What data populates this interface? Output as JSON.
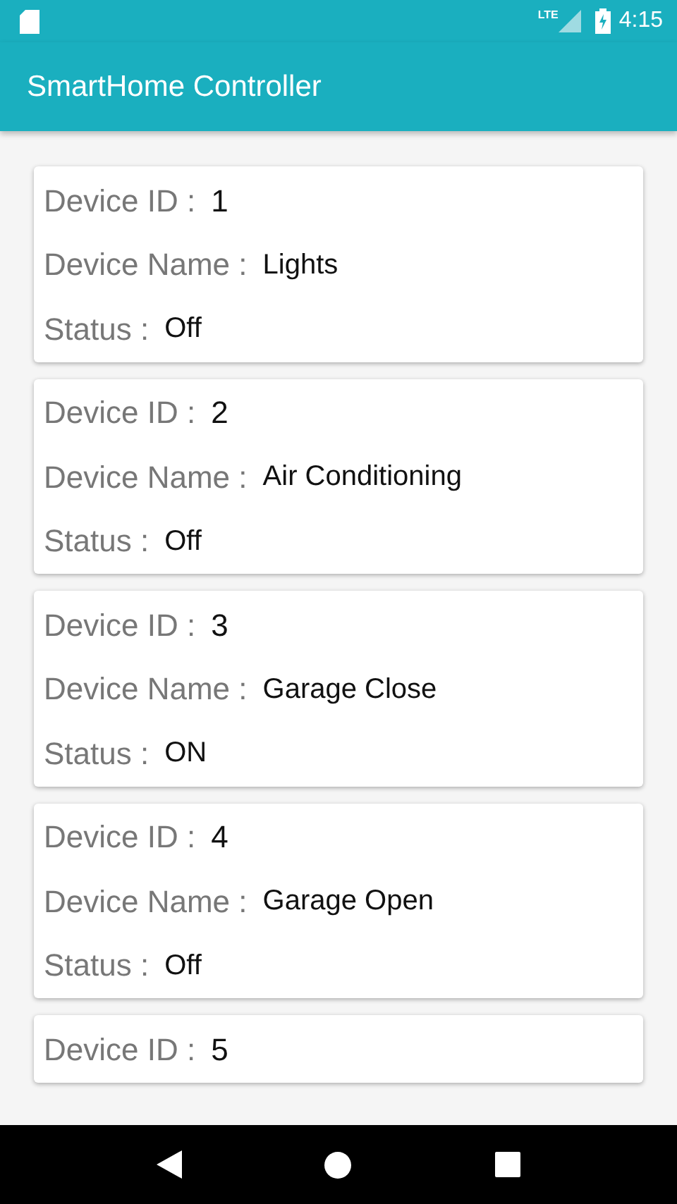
{
  "status_bar": {
    "network": "LTE",
    "time": "4:15"
  },
  "app_bar": {
    "title": "SmartHome Controller"
  },
  "devices": [
    {
      "fields": [
        {
          "label": "Device ID :",
          "value": "1"
        },
        {
          "label": "Device Name :",
          "value": "Lights"
        },
        {
          "label": "Status :",
          "value": "Off"
        }
      ]
    },
    {
      "fields": [
        {
          "label": "Device ID :",
          "value": "2"
        },
        {
          "label": "Device Name :",
          "value": "Air Conditioning"
        },
        {
          "label": "Status :",
          "value": "Off"
        }
      ]
    },
    {
      "fields": [
        {
          "label": "Device ID :",
          "value": "3"
        },
        {
          "label": "Device Name :",
          "value": "Garage Close"
        },
        {
          "label": "Status :",
          "value": "ON"
        }
      ]
    },
    {
      "fields": [
        {
          "label": "Device ID :",
          "value": "4"
        },
        {
          "label": "Device Name :",
          "value": "Garage Open"
        },
        {
          "label": "Status :",
          "value": "Off"
        }
      ]
    },
    {
      "fields": [
        {
          "label": "Device ID :",
          "value": "5"
        }
      ]
    }
  ]
}
